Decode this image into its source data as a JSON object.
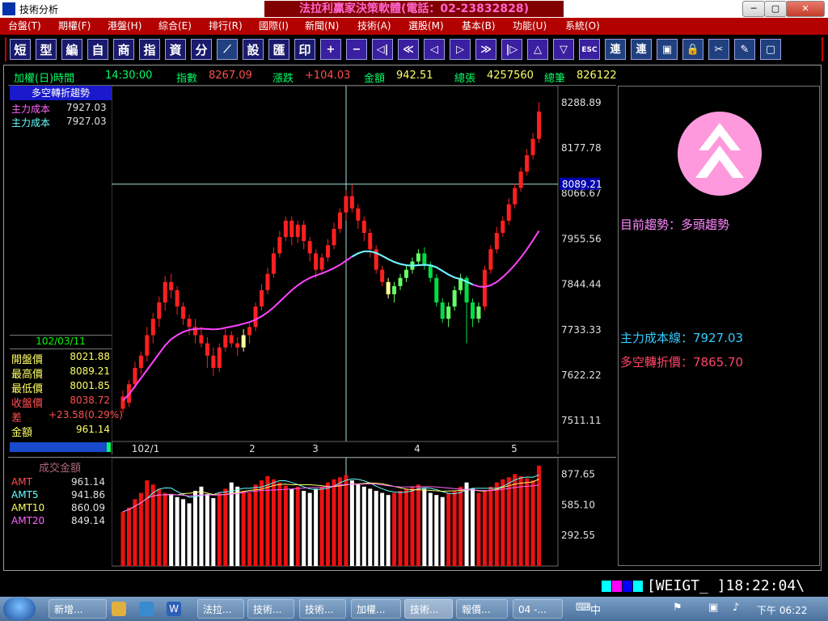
{
  "window": {
    "title": "技術分析",
    "banner": "法拉利贏家決策軟體(電話：02-23832828)",
    "controls": {
      "minimize": "─",
      "maximize": "▢",
      "close": "✕"
    }
  },
  "menu": [
    "台盤(T)",
    "期權(F)",
    "港盤(H)",
    "綜合(E)",
    "排行(R)",
    "國際(I)",
    "新聞(N)",
    "技術(A)",
    "選股(M)",
    "基本(B)",
    "功能(U)",
    "系統(O)"
  ],
  "toolbar": {
    "text_buttons": [
      "短",
      "型",
      "編",
      "自",
      "商",
      "指",
      "資",
      "分"
    ],
    "mid_buttons": [
      "設",
      "匯",
      "印"
    ],
    "arrows": [
      "+",
      "−",
      "◁|",
      "≪",
      "◁",
      "▷",
      "≫",
      "|▷",
      "△",
      "▽",
      "ESC"
    ],
    "tools": [
      "連",
      "連",
      "▣",
      "🔒",
      "✂",
      "✎",
      "▢"
    ]
  },
  "info": {
    "name_label": "加權(日)時間",
    "time": "14:30:00",
    "index_label": "指數",
    "index": "8267.09",
    "change_label": "漲跌",
    "change": "+104.03",
    "amount_label": "金額",
    "amount": "942.51",
    "total_vol_label": "總張",
    "total_vol": "4257560",
    "total_cnt_label": "總筆",
    "total_cnt": "826122"
  },
  "left": {
    "trend_title": "多空轉折趨勢",
    "cost1_label": "主力成本",
    "cost1": "7927.03",
    "cost2_label": "主力成本",
    "cost2": "7927.03",
    "date": "102/03/11",
    "ohlc": [
      {
        "label": "開盤價",
        "value": "8021.88",
        "color": "#ffff66"
      },
      {
        "label": "最高價",
        "value": "8089.21",
        "color": "#ffff66"
      },
      {
        "label": "最低價",
        "value": "8001.85",
        "color": "#ffff66"
      },
      {
        "label": "收盤價",
        "value": "8038.72",
        "color": "#ff5050"
      },
      {
        "label": "差",
        "value": "+23.58(0.29%)",
        "color": "#ff5050"
      },
      {
        "label": "金額",
        "value": "961.14",
        "color": "#ffff66"
      }
    ]
  },
  "volume_panel": {
    "title": "成交金額",
    "rows": [
      {
        "label": "AMT",
        "value": "961.14",
        "color": "#ff5050"
      },
      {
        "label": "AMT5",
        "value": "941.86",
        "color": "#66ffff"
      },
      {
        "label": "AMT10",
        "value": "860.09",
        "color": "#ffff66"
      },
      {
        "label": "AMT20",
        "value": "849.14",
        "color": "#ff66ff"
      }
    ],
    "axis": [
      "877.65",
      "585.10",
      "292.55"
    ]
  },
  "right": {
    "trend_label": "目前趨勢：多頭趨勢",
    "cost_line_label": "主力成本線：7927.03",
    "turn_price_label": "多空轉折價：7865.70"
  },
  "status": {
    "text": "[WEIGT_ ]18:22:04\\"
  },
  "taskbar": {
    "items": [
      "新增...",
      "法拉...",
      "技術...",
      "技術...",
      "加權...",
      "技術...",
      "報價...",
      "04 -..."
    ],
    "clock": "下午 06:22",
    "tray": "中"
  },
  "chart_data": {
    "type": "candlestick",
    "y_axis_labels": [
      "8288.89",
      "8177.78",
      "8066.67",
      "7955.56",
      "7844.44",
      "7733.33",
      "7622.22",
      "7511.11"
    ],
    "crosshair_value": "8089.21",
    "x_axis_labels": [
      "102/1",
      "2",
      "3",
      "4",
      "5"
    ],
    "ylim": [
      7460,
      8330
    ],
    "candles": [
      [
        7540,
        7570,
        7530,
        7585
      ],
      [
        7555,
        7600,
        7545,
        7610
      ],
      [
        7600,
        7640,
        7590,
        7655
      ],
      [
        7640,
        7670,
        7625,
        7680
      ],
      [
        7670,
        7720,
        7655,
        7740
      ],
      [
        7720,
        7760,
        7700,
        7775
      ],
      [
        7760,
        7800,
        7740,
        7815
      ],
      [
        7800,
        7850,
        7780,
        7865
      ],
      [
        7850,
        7830,
        7810,
        7870
      ],
      [
        7830,
        7790,
        7770,
        7840
      ],
      [
        7790,
        7760,
        7745,
        7800
      ],
      [
        7760,
        7740,
        7720,
        7770
      ],
      [
        7740,
        7720,
        7700,
        7760
      ],
      [
        7720,
        7700,
        7690,
        7740
      ],
      [
        7700,
        7670,
        7640,
        7715
      ],
      [
        7670,
        7640,
        7620,
        7690
      ],
      [
        7640,
        7690,
        7630,
        7700
      ],
      [
        7690,
        7720,
        7680,
        7735
      ],
      [
        7720,
        7700,
        7690,
        7730
      ],
      [
        7700,
        7690,
        7670,
        7715
      ],
      [
        7690,
        7720,
        7680,
        7735
      ],
      [
        7720,
        7740,
        7700,
        7750
      ],
      [
        7740,
        7790,
        7730,
        7800
      ],
      [
        7790,
        7830,
        7780,
        7845
      ],
      [
        7830,
        7870,
        7820,
        7885
      ],
      [
        7870,
        7920,
        7860,
        7935
      ],
      [
        7920,
        7960,
        7910,
        7975
      ],
      [
        7960,
        8000,
        7950,
        8010
      ],
      [
        8000,
        7960,
        7940,
        8010
      ],
      [
        7960,
        7990,
        7945,
        8000
      ],
      [
        7990,
        7950,
        7930,
        8000
      ],
      [
        7950,
        7920,
        7900,
        7960
      ],
      [
        7920,
        7880,
        7860,
        7930
      ],
      [
        7880,
        7910,
        7870,
        7920
      ],
      [
        7910,
        7940,
        7900,
        7955
      ],
      [
        7940,
        7980,
        7930,
        7995
      ],
      [
        7980,
        8020,
        7970,
        8030
      ],
      [
        8020,
        8060,
        8000,
        8075
      ],
      [
        8060,
        8030,
        8020,
        8089
      ],
      [
        8030,
        8000,
        7980,
        8040
      ],
      [
        8000,
        7970,
        7950,
        8010
      ],
      [
        7970,
        7930,
        7910,
        7980
      ],
      [
        7930,
        7880,
        7870,
        7940
      ],
      [
        7880,
        7850,
        7840,
        7890
      ],
      [
        7850,
        7820,
        7810,
        7860
      ],
      [
        7820,
        7840,
        7800,
        7850
      ],
      [
        7840,
        7860,
        7830,
        7870
      ],
      [
        7860,
        7880,
        7850,
        7890
      ],
      [
        7880,
        7900,
        7870,
        7910
      ],
      [
        7900,
        7920,
        7890,
        7930
      ],
      [
        7920,
        7890,
        7880,
        7935
      ],
      [
        7890,
        7860,
        7850,
        7900
      ],
      [
        7860,
        7800,
        7790,
        7870
      ],
      [
        7800,
        7760,
        7750,
        7810
      ],
      [
        7760,
        7790,
        7740,
        7800
      ],
      [
        7790,
        7830,
        7780,
        7840
      ],
      [
        7830,
        7860,
        7820,
        7870
      ],
      [
        7860,
        7800,
        7700,
        7865
      ],
      [
        7800,
        7760,
        7740,
        7810
      ],
      [
        7760,
        7790,
        7750,
        7800
      ],
      [
        7790,
        7880,
        7780,
        7890
      ],
      [
        7880,
        7930,
        7870,
        7940
      ],
      [
        7930,
        7970,
        7920,
        7985
      ],
      [
        7970,
        8000,
        7960,
        8010
      ],
      [
        8000,
        8040,
        7990,
        8055
      ],
      [
        8040,
        8080,
        8030,
        8090
      ],
      [
        8080,
        8120,
        8070,
        8130
      ],
      [
        8120,
        8160,
        8110,
        8175
      ],
      [
        8160,
        8200,
        8150,
        8215
      ],
      [
        8200,
        8267,
        8190,
        8290
      ]
    ],
    "ma": [
      7560,
      7575,
      7595,
      7615,
      7635,
      7655,
      7675,
      7695,
      7710,
      7720,
      7728,
      7733,
      7735,
      7736,
      7735,
      7734,
      7735,
      7738,
      7741,
      7744,
      7748,
      7752,
      7758,
      7766,
      7776,
      7788,
      7802,
      7816,
      7830,
      7842,
      7852,
      7860,
      7866,
      7871,
      7877,
      7884,
      7892,
      7902,
      7912,
      7920,
      7925,
      7925,
      7921,
      7914,
      7906,
      7899,
      7894,
      7891,
      7890,
      7891,
      7892,
      7891,
      7886,
      7877,
      7868,
      7861,
      7857,
      7851,
      7844,
      7839,
      7838,
      7842,
      7850,
      7862,
      7876,
      7892,
      7910,
      7930,
      7952,
      7975
    ],
    "volume": [
      520,
      560,
      640,
      700,
      820,
      780,
      740,
      700,
      690,
      660,
      640,
      600,
      720,
      760,
      690,
      650,
      700,
      740,
      800,
      760,
      720,
      700,
      780,
      820,
      860,
      830,
      800,
      770,
      740,
      760,
      720,
      700,
      740,
      760,
      800,
      830,
      850,
      870,
      820,
      780,
      760,
      740,
      720,
      700,
      680,
      700,
      720,
      740,
      760,
      780,
      740,
      700,
      680,
      660,
      700,
      720,
      760,
      800,
      740,
      700,
      720,
      760,
      800,
      830,
      850,
      880,
      860,
      840,
      820,
      961
    ],
    "volume_ylim": [
      0,
      960
    ]
  }
}
